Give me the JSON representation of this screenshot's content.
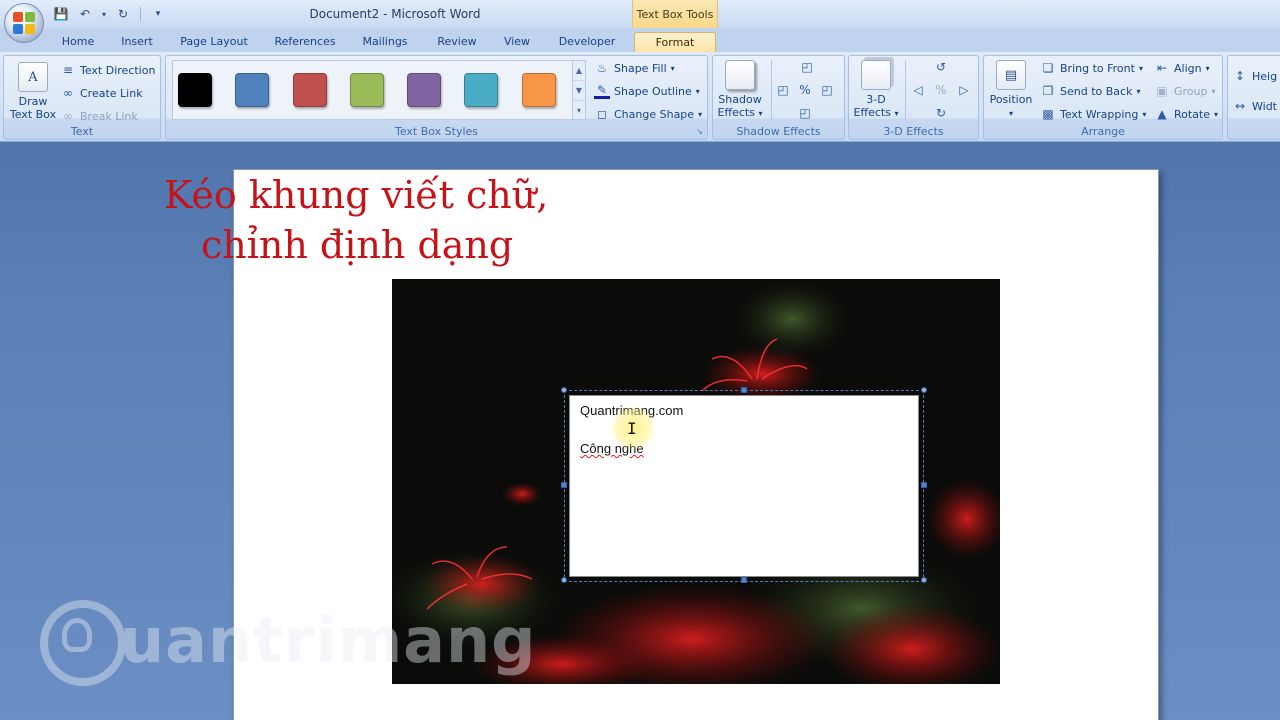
{
  "window": {
    "title": "Document2 - Microsoft Word",
    "contextual_group": "Text Box Tools"
  },
  "tabs": [
    "Home",
    "Insert",
    "Page Layout",
    "References",
    "Mailings",
    "Review",
    "View",
    "Developer",
    "Format"
  ],
  "active_tab": "Format",
  "ribbon": {
    "text_group": {
      "label": "Text",
      "draw_text_box": "Draw Text Box",
      "text_direction": "Text Direction",
      "create_link": "Create Link",
      "break_link": "Break Link"
    },
    "styles_group": {
      "label": "Text Box Styles",
      "swatches": [
        "#000000",
        "#4f81bd",
        "#c0504d",
        "#9bbb59",
        "#8064a2",
        "#4bacc6",
        "#f79646"
      ],
      "shape_fill": "Shape Fill",
      "shape_outline": "Shape Outline",
      "change_shape": "Change Shape"
    },
    "shadow_group": {
      "label": "Shadow Effects",
      "shadow_effects": "Shadow Effects"
    },
    "threed_group": {
      "label": "3-D Effects",
      "threed_effects": "3-D Effects"
    },
    "arrange_group": {
      "label": "Arrange",
      "position": "Position",
      "bring_to_front": "Bring to Front",
      "send_to_back": "Send to Back",
      "text_wrapping": "Text Wrapping",
      "align": "Align",
      "group": "Group",
      "rotate": "Rotate"
    },
    "size_group": {
      "height": "Heig",
      "width": "Widt"
    }
  },
  "document": {
    "caption_line1": "Kéo khung viết chữ,",
    "caption_line2": "chỉnh định dạng",
    "caption_color": "#c4141a",
    "textbox_line1": "Quantrimang.com",
    "textbox_line2": "Công nghe"
  },
  "watermark": "uantrimang"
}
